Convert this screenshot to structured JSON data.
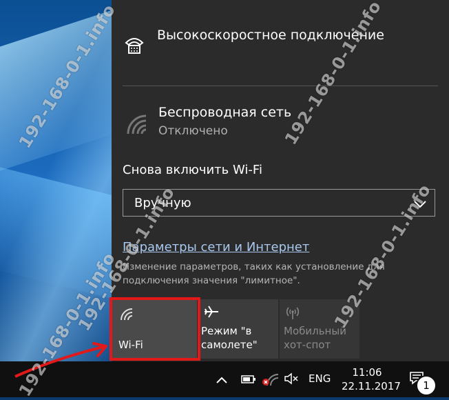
{
  "network": {
    "connection_name": "Высокоскоростное подключение",
    "wifi_name": "Беспроводная сеть",
    "wifi_status": "Отключено"
  },
  "reenable": {
    "label": "Снова включить Wi-Fi",
    "selected": "Вручную"
  },
  "settings": {
    "link": "Параметры сети и Интернет",
    "description": "Изменение параметров, таких как установление для подключения значения \"лимитное\"."
  },
  "quick_actions": {
    "wifi": "Wi-Fi",
    "airplane": "Режим \"в самолете\"",
    "hotspot": "Мобильный хот-спот"
  },
  "taskbar": {
    "language": "ENG",
    "time": "11:06",
    "date": "22.11.2017",
    "notification_count": "1"
  },
  "watermark": "192-168-0-1.info",
  "colors": {
    "flyout_bg": "#2b2b2b",
    "highlight": "#e31919",
    "link": "#a8c8ef",
    "taskbar_bg": "#101010"
  }
}
